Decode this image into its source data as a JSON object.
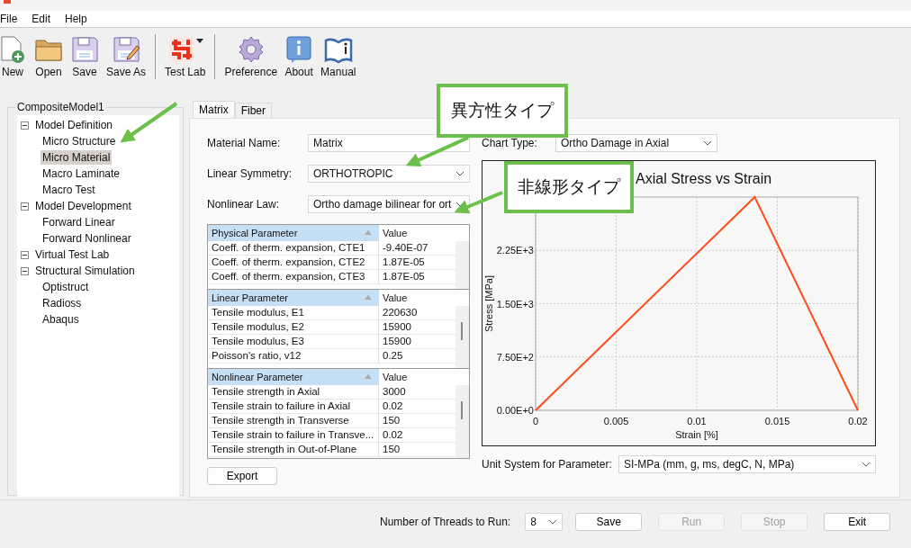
{
  "menu": [
    "File",
    "Edit",
    "Help"
  ],
  "toolbar_groups": [
    [
      {
        "label": "New",
        "kind": "new"
      },
      {
        "label": "Open",
        "kind": "open"
      },
      {
        "label": "Save",
        "kind": "save"
      },
      {
        "label": "Save As",
        "kind": "saveas"
      }
    ],
    [
      {
        "label": "Test Lab",
        "kind": "testlab"
      }
    ],
    [
      {
        "label": "Preference",
        "kind": "gear"
      },
      {
        "label": "About",
        "kind": "about"
      },
      {
        "label": "Manual",
        "kind": "manual"
      }
    ]
  ],
  "tree": {
    "root": "CompositeModel1",
    "items": [
      {
        "label": "Model Definition",
        "expanded": true,
        "children": [
          {
            "label": "Micro Structure",
            "selected": false
          },
          {
            "label": "Micro Material",
            "selected": true
          },
          {
            "label": "Macro Laminate",
            "selected": false
          },
          {
            "label": "Macro Test",
            "selected": false
          }
        ]
      },
      {
        "label": "Model Development",
        "expanded": true,
        "children": [
          {
            "label": "Forward Linear",
            "selected": false
          },
          {
            "label": "Forward Nonlinear",
            "selected": false
          }
        ]
      },
      {
        "label": "Virtual Test Lab",
        "expanded": true
      },
      {
        "label": "Structural Simulation",
        "expanded": true,
        "children": [
          {
            "label": "Optistruct",
            "selected": false
          },
          {
            "label": "Radioss",
            "selected": false
          },
          {
            "label": "Abaqus",
            "selected": false
          }
        ]
      }
    ]
  },
  "tabs": [
    {
      "label": "Matrix",
      "selected": true
    },
    {
      "label": "Fiber",
      "selected": false
    }
  ],
  "form": [
    {
      "label": "Material Name:",
      "value": "Matrix",
      "kind": "text"
    },
    {
      "label": "Linear Symmetry:",
      "value": "ORTHOTROPIC",
      "kind": "select"
    },
    {
      "label": "Nonlinear Law:",
      "value": "Ortho damage bilinear for ort",
      "kind": "select"
    }
  ],
  "chart_type": {
    "label": "Chart Type:",
    "value": "Ortho Damage in Axial"
  },
  "tables": [
    {
      "header": "Physical Parameter",
      "value_header": "Value",
      "rows": [
        [
          "Coeff. of therm. expansion, CTE1",
          "-9.40E-07"
        ],
        [
          "Coeff. of therm. expansion, CTE2",
          "1.87E-05"
        ],
        [
          "Coeff. of therm. expansion, CTE3",
          "1.87E-05"
        ]
      ]
    },
    {
      "header": "Linear Parameter",
      "value_header": "Value",
      "rows": [
        [
          "Tensile modulus, E1",
          "220630"
        ],
        [
          "Tensile modulus, E2",
          "15900"
        ],
        [
          "Tensile modulus, E3",
          "15900"
        ],
        [
          "Poisson's ratio, v12",
          "0.25"
        ]
      ]
    },
    {
      "header": "Nonlinear Parameter",
      "value_header": "Value",
      "rows": [
        [
          "Tensile strength in Axial",
          "3000"
        ],
        [
          "Tensile strain to failure in Axial",
          "0.02"
        ],
        [
          "Tensile strength in Transverse",
          "150"
        ],
        [
          "Tensile strain to failure in Transve...",
          "0.02"
        ],
        [
          "Tensile strength in Out-of-Plane",
          "150"
        ]
      ]
    }
  ],
  "chart": {
    "chart_data": {
      "type": "line",
      "title": "Axial Stress vs Strain",
      "xlabel": "Strain [%]",
      "ylabel": "Stress [MPa]",
      "x": [
        0,
        0.0136,
        0.02
      ],
      "series": [
        {
          "color": "#ff4a1c",
          "values": [
            0,
            3000,
            0
          ]
        }
      ],
      "grid": true,
      "xlim": [
        0,
        0.02
      ],
      "ylim": [
        0,
        3000
      ],
      "xticks": [
        {
          "value": 0,
          "label": "0"
        },
        {
          "value": 0.005,
          "label": "0.005"
        },
        {
          "value": 0.01,
          "label": "0.01"
        },
        {
          "value": 0.015,
          "label": "0.015"
        },
        {
          "value": 0.02,
          "label": "0.02"
        }
      ],
      "yticks": [
        {
          "value": 0,
          "label": "0.00E+0"
        },
        {
          "value": 750,
          "label": "7.50E+2"
        },
        {
          "value": 1500,
          "label": "1.50E+3"
        },
        {
          "value": 2250,
          "label": "2.25E+3"
        }
      ]
    }
  },
  "export": "Export",
  "unit_system": {
    "label": "Unit System for Parameter:",
    "value": "SI-MPa (mm, g, ms, degC, N, MPa)"
  },
  "threads": {
    "label": "Number of Threads to Run:",
    "value": "8"
  },
  "buttons": [
    {
      "label": "Save",
      "disabled": false
    },
    {
      "label": "Run",
      "disabled": true
    },
    {
      "label": "Stop",
      "disabled": true
    },
    {
      "label": "Exit",
      "disabled": false
    }
  ],
  "callouts": [
    "異方性タイプ",
    "非線形タイプ"
  ]
}
